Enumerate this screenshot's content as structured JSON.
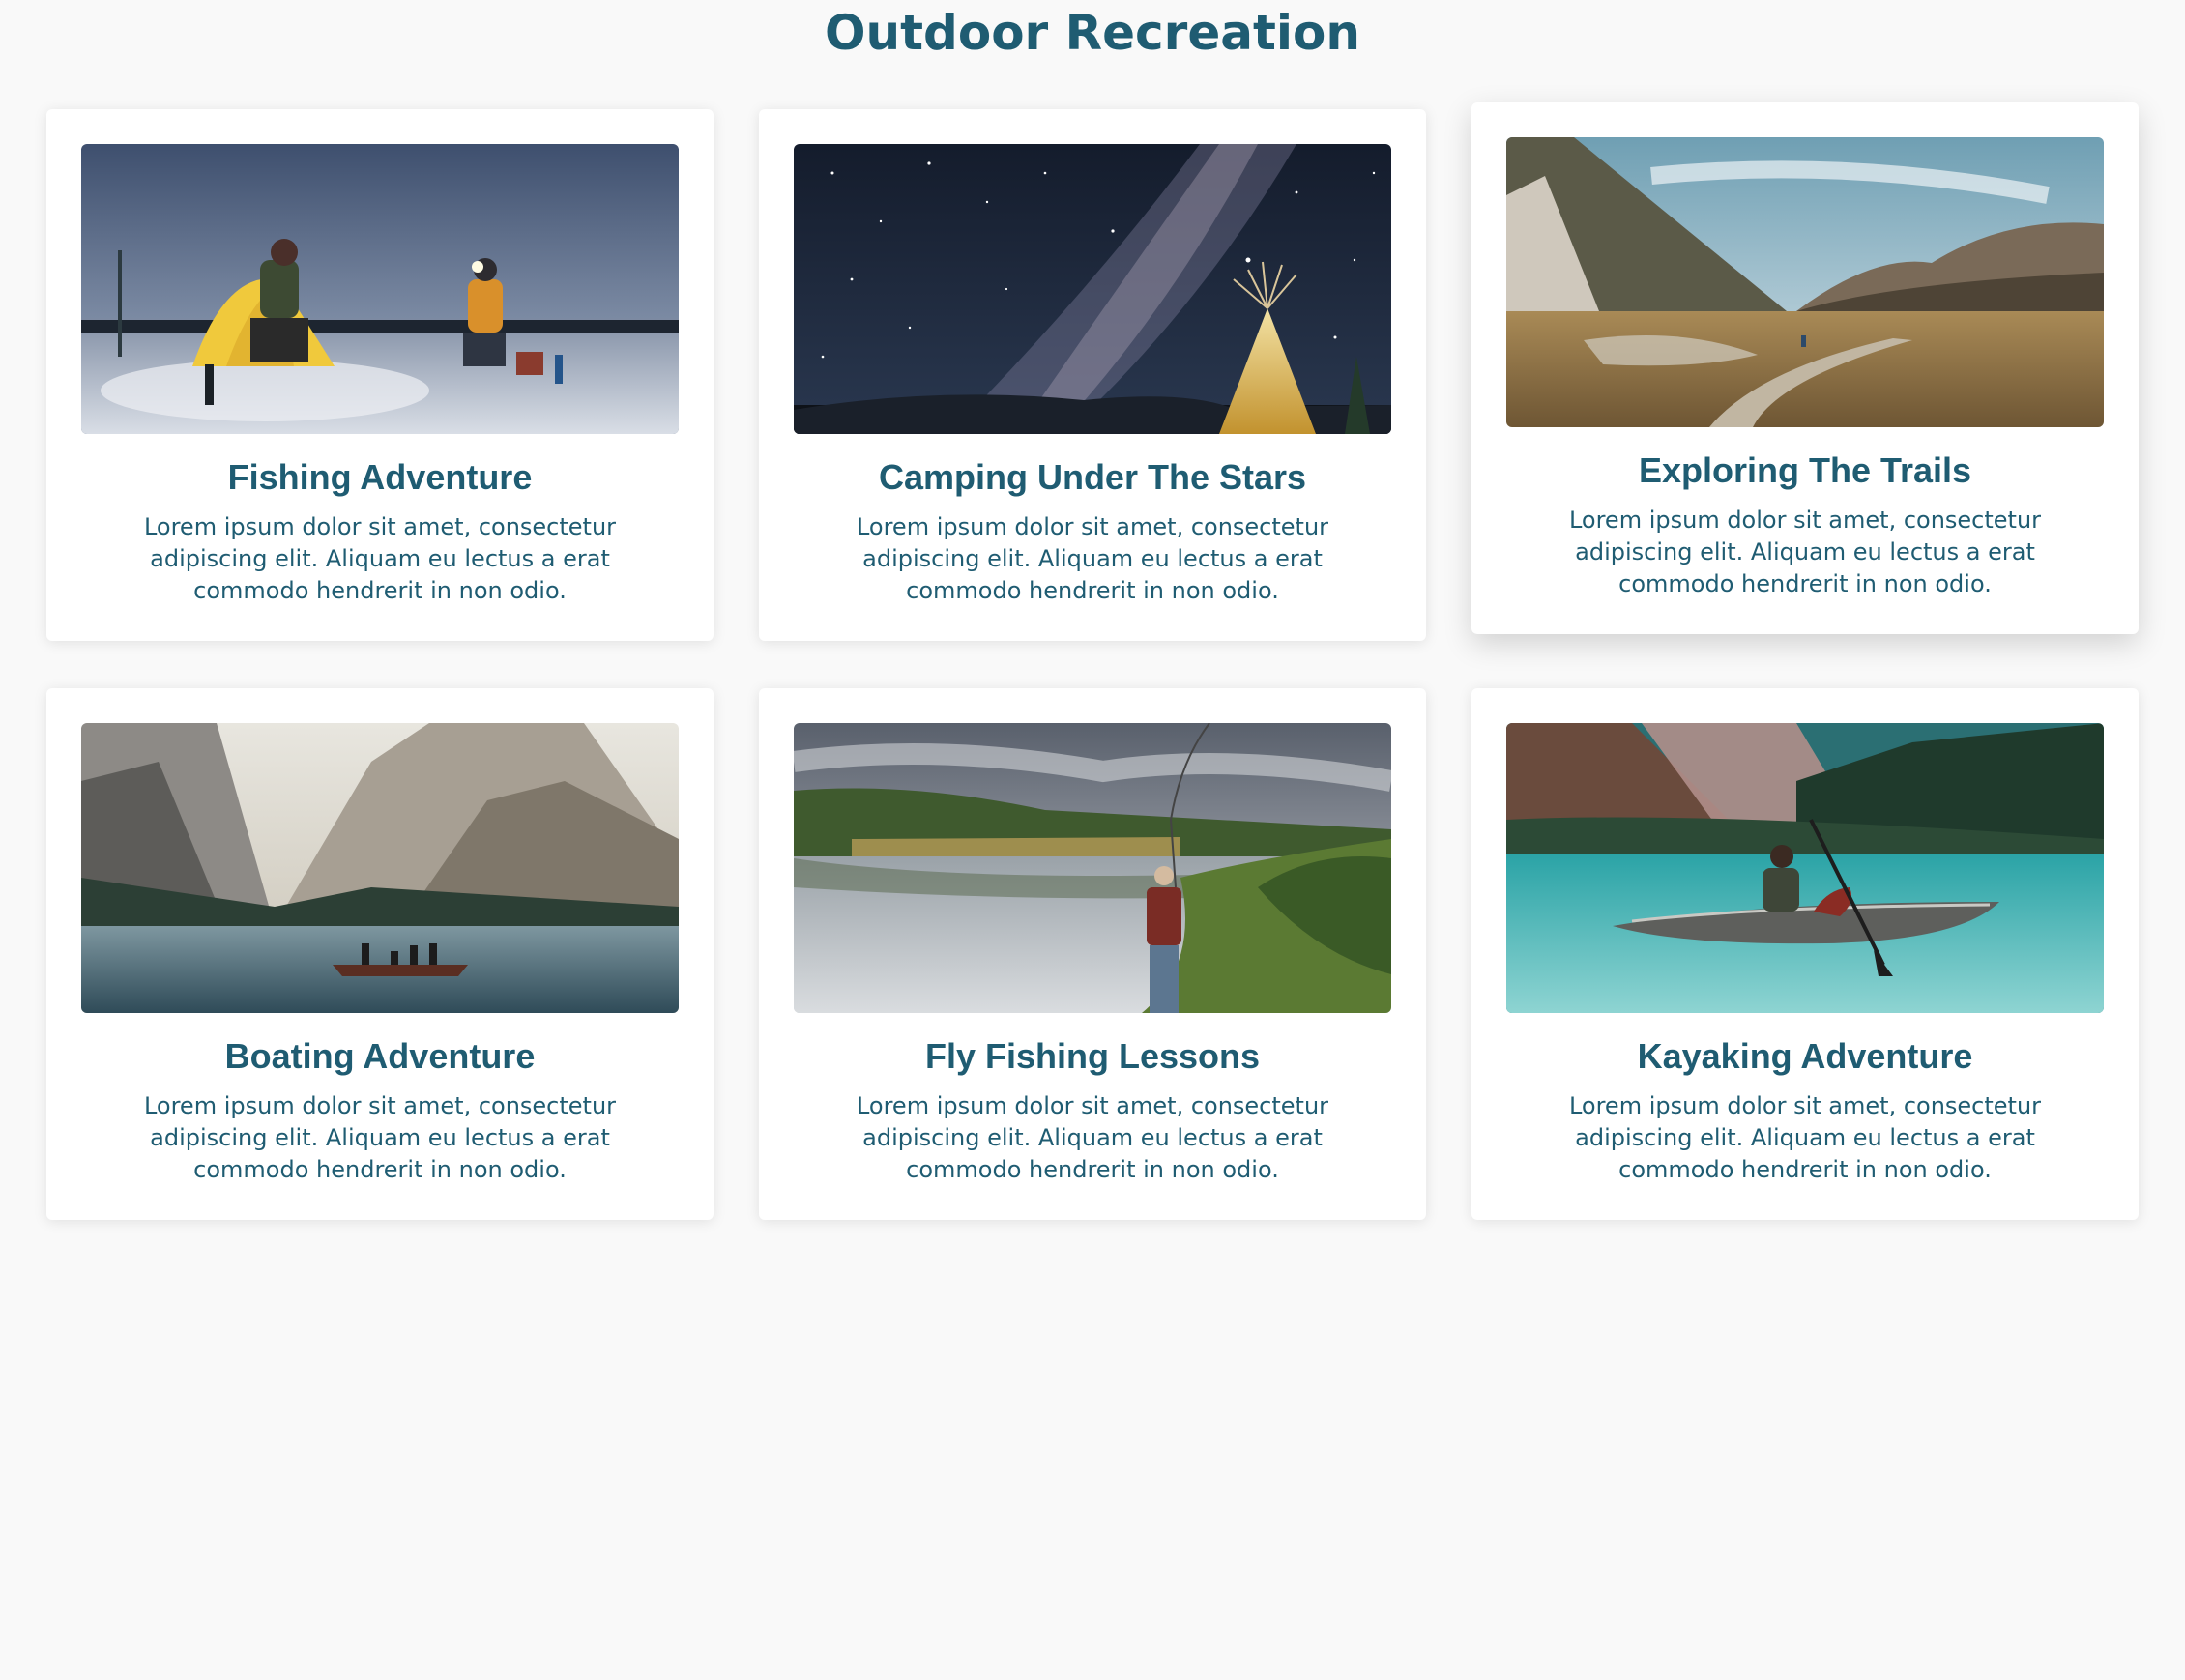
{
  "page": {
    "title": "Outdoor Recreation"
  },
  "cards": [
    {
      "title": "Fishing Adventure",
      "text": "Lorem ipsum dolor sit amet, consectetur adipiscing elit. Aliquam eu lectus a erat commodo hendrerit in non odio.",
      "image": "ice-fishing-photo"
    },
    {
      "title": "Camping Under The Stars",
      "text": "Lorem ipsum dolor sit amet, consectetur adipiscing elit. Aliquam eu lectus a erat commodo hendrerit in non odio.",
      "image": "milky-way-teepee-photo"
    },
    {
      "title": "Exploring The Trails",
      "text": "Lorem ipsum dolor sit amet, consectetur adipiscing elit. Aliquam eu lectus a erat commodo hendrerit in non odio.",
      "image": "mountain-boardwalk-photo"
    },
    {
      "title": "Boating Adventure",
      "text": "Lorem ipsum dolor sit amet, consectetur adipiscing elit. Aliquam eu lectus a erat commodo hendrerit in non odio.",
      "image": "mountain-lake-boat-photo"
    },
    {
      "title": "Fly Fishing Lessons",
      "text": "Lorem ipsum dolor sit amet, consectetur adipiscing elit. Aliquam eu lectus a erat commodo hendrerit in non odio.",
      "image": "river-fly-fishing-photo"
    },
    {
      "title": "Kayaking Adventure",
      "text": "Lorem ipsum dolor sit amet, consectetur adipiscing elit. Aliquam eu lectus a erat commodo hendrerit in non odio.",
      "image": "lake-kayak-photo"
    }
  ],
  "colors": {
    "accent": "#1f5c72",
    "background": "#f9f9f9",
    "card": "#ffffff"
  }
}
